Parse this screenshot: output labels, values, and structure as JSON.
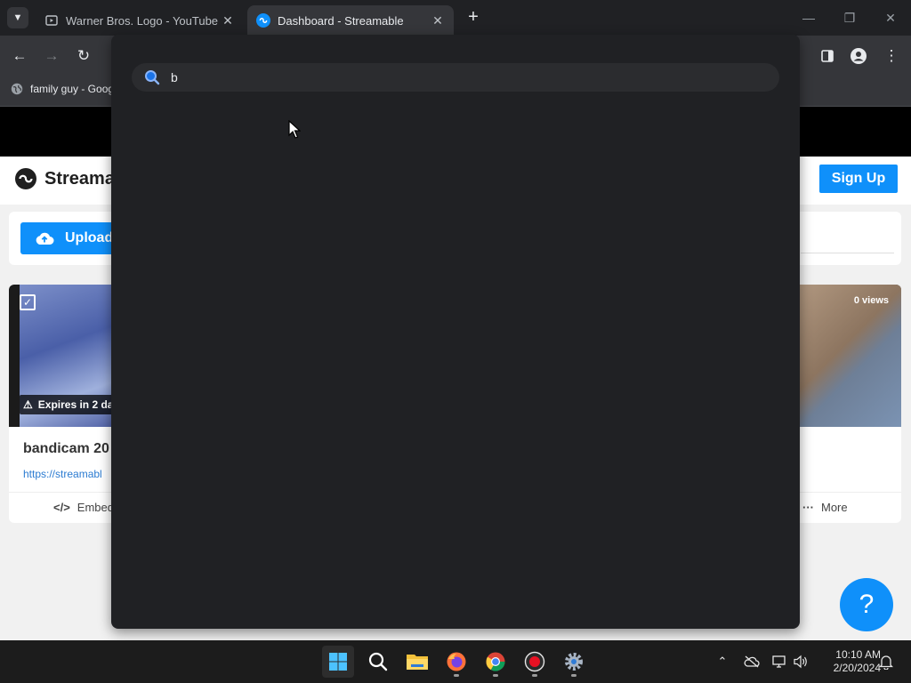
{
  "browser": {
    "tabs": [
      {
        "title": "Warner Bros. Logo - YouTube",
        "favicon": "youtube-icon",
        "active": false
      },
      {
        "title": "Dashboard - Streamable",
        "favicon": "streamable-icon",
        "active": true
      }
    ],
    "bookmarks": [
      {
        "label": "family guy - Goog",
        "icon": "globe-icon"
      }
    ],
    "omnibox": {
      "value": "b",
      "placeholder": ""
    }
  },
  "page": {
    "logo_text": "Streama",
    "signup_label": "Sign Up",
    "upload_label": "Upload",
    "video": {
      "title": "bandicam 20",
      "link": "https://streamabl",
      "expires": "Expires in 2 da",
      "views": "0 views",
      "actions": {
        "embed": "Embed",
        "more": "More"
      }
    },
    "help_label": "?"
  },
  "taskbar": {
    "time": "10:10 AM",
    "date": "2/20/2024"
  },
  "colors": {
    "accent": "#0f90fa",
    "chrome_dark": "#202124",
    "chrome_mid": "#35363a"
  }
}
